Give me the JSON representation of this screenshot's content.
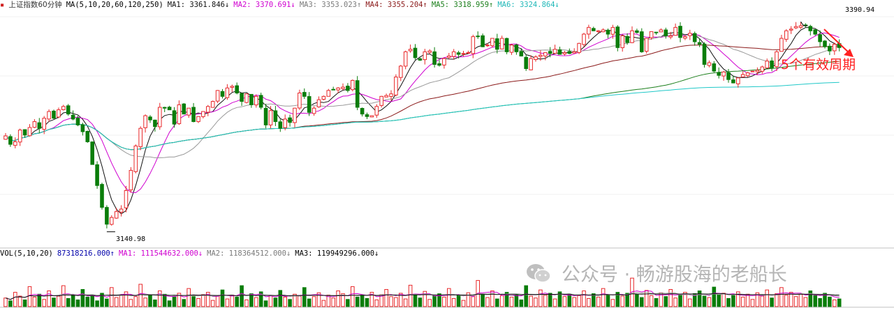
{
  "header": {
    "marker": "▪",
    "title": "上证指数60分钟",
    "ma_label": "MA(5,10,20,60,120,250)",
    "ma1": "MA1: 3361.846↓",
    "ma2": "MA2: 3370.691↓",
    "ma3": "MA3: 3353.023↑",
    "ma4": "MA4: 3355.204↑",
    "ma5": "MA5: 3318.959↑",
    "ma6": "MA6: 3324.864↓"
  },
  "volume_header": {
    "label": "VOL(5,10,20)",
    "value": "87318216.000↑",
    "ma1": "MA1: 111544632.000↓",
    "ma2": "MA2: 118364512.000↓",
    "ma3": "MA3: 119949296.000↓"
  },
  "annotations": {
    "high_label": "3390.94",
    "low_label": "3140.98",
    "note": "5个有效周期"
  },
  "watermark": {
    "text": "公众号 · 畅游股海的老船长",
    "logo": "wechat-logo"
  },
  "colors": {
    "up": "#e8282a",
    "down": "#0a7d0a",
    "ma1": "#101010",
    "ma2": "#d000d0",
    "ma3": "#9a9a9a",
    "ma4": "#8b1a1a",
    "ma5": "#1b7f1b",
    "ma6": "#20c8c8",
    "note": "#ff2020"
  },
  "chart_data": [
    {
      "type": "candlestick",
      "title": "上证指数60分钟",
      "ylim": [
        3125,
        3405
      ],
      "high": 3390.94,
      "low": 3140.98,
      "close": [
        3255.0,
        3245.0,
        3248.0,
        3262.0,
        3256.0,
        3265.0,
        3272.0,
        3264.0,
        3276.0,
        3284.0,
        3276.0,
        3286.0,
        3290.0,
        3281.0,
        3275.0,
        3268.0,
        3260.0,
        3248.0,
        3221.0,
        3196.0,
        3170.0,
        3150.0,
        3158.0,
        3165.0,
        3168.0,
        3190.0,
        3214.0,
        3243.0,
        3264.0,
        3279.0,
        3274.0,
        3266.0,
        3289.0,
        3288.0,
        3286.0,
        3269.0,
        3292.0,
        3281.0,
        3288.0,
        3272.0,
        3278.0,
        3284.0,
        3290.0,
        3296.0,
        3309.0,
        3302.0,
        3312.0,
        3314.0,
        3306.0,
        3296.0,
        3305.0,
        3292.0,
        3302.0,
        3289.0,
        3268.0,
        3285.0,
        3272.0,
        3264.0,
        3275.0,
        3271.0,
        3288.0,
        3306.0,
        3302.0,
        3283.0,
        3288.0,
        3298.0,
        3302.0,
        3309.0,
        3310.0,
        3312.0,
        3313.0,
        3309.0,
        3321.0,
        3289.0,
        3281.0,
        3278.0,
        3279.0,
        3290.0,
        3302.0,
        3303.0,
        3305.0,
        3325.0,
        3338.0,
        3355.0,
        3358.0,
        3348.0,
        3345.0,
        3355.0,
        3356.0,
        3340.0,
        3339.0,
        3347.0,
        3350.0,
        3355.0,
        3352.0,
        3353.0,
        3354.0,
        3373.0,
        3373.0,
        3361.0,
        3363.0,
        3371.0,
        3358.0,
        3371.0,
        3355.0,
        3363.0,
        3355.0,
        3350.0,
        3335.0,
        3347.0,
        3349.0,
        3351.0,
        3354.0,
        3353.0,
        3358.0,
        3352.0,
        3354.0,
        3353.0,
        3355.0,
        3365.0,
        3376.0,
        3384.0,
        3380.0,
        3380.0,
        3381.0,
        3376.0,
        3384.0,
        3360.0,
        3374.0,
        3366.0,
        3380.0,
        3378.0,
        3355.0,
        3371.0,
        3379.0,
        3378.0,
        3381.0,
        3374.0,
        3374.0,
        3384.0,
        3372.0,
        3373.0,
        3377.0,
        3367.0,
        3364.0,
        3340.0,
        3342.0,
        3332.0,
        3327.0,
        3331.0,
        3322.0,
        3318.0,
        3324.0,
        3328.0,
        3330.0,
        3332.0,
        3333.0,
        3337.0,
        3344.0,
        3336.0,
        3355.0,
        3371.0,
        3380.0,
        3382.0,
        3385.0,
        3386.0,
        3386.0,
        3380.0,
        3376.0,
        3367.0,
        3361.0,
        3356.0,
        3364.0,
        3360.0
      ],
      "ma_series": [
        {
          "name": "MA1",
          "period": 5,
          "color_key": "ma1"
        },
        {
          "name": "MA2",
          "period": 10,
          "color_key": "ma2"
        },
        {
          "name": "MA3",
          "period": 20,
          "color_key": "ma3"
        },
        {
          "name": "MA4",
          "period": 60,
          "color_key": "ma4"
        },
        {
          "name": "MA5",
          "period": 120,
          "color_key": "ma5"
        },
        {
          "name": "MA6",
          "period": 250,
          "color_key": "ma6"
        }
      ]
    },
    {
      "type": "bar",
      "title": "VOL(5,10,20)",
      "ylim": [
        0,
        100
      ],
      "note": "relative volume levels (0-100)",
      "values": [
        18,
        12,
        30,
        22,
        14,
        42,
        20,
        26,
        15,
        33,
        18,
        22,
        44,
        17,
        25,
        14,
        36,
        20,
        22,
        12,
        28,
        16,
        40,
        19,
        24,
        31,
        15,
        21,
        47,
        18,
        23,
        14,
        33,
        26,
        12,
        20,
        28,
        15,
        38,
        21,
        17,
        25,
        30,
        13,
        22,
        35,
        16,
        24,
        20,
        44,
        14,
        27,
        19,
        31,
        12,
        23,
        18,
        34,
        20,
        15,
        26,
        22,
        40,
        16,
        21,
        29,
        13,
        24,
        18,
        33,
        27,
        15,
        42,
        20,
        23,
        17,
        30,
        14,
        25,
        36,
        21,
        19,
        28,
        16,
        45,
        24,
        18,
        32,
        15,
        22,
        27,
        20,
        38,
        17,
        24,
        13,
        29,
        21,
        55,
        26,
        19,
        33,
        16,
        23,
        30,
        20,
        25,
        14,
        44,
        22,
        18,
        35,
        24,
        28,
        16,
        31,
        21,
        26,
        19,
        23,
        33,
        17,
        27,
        20,
        38,
        24,
        15,
        30,
        22,
        28,
        60,
        25,
        19,
        34,
        23,
        17,
        29,
        21,
        36,
        18,
        24,
        30,
        16,
        27,
        33,
        22,
        19,
        41,
        25,
        28,
        17,
        23,
        31,
        20,
        26,
        15,
        29,
        22,
        35,
        18,
        27,
        40,
        24,
        30,
        21,
        26,
        19,
        33,
        23,
        17,
        28,
        20,
        14,
        16
      ],
      "ma_series": [
        {
          "name": "MA1",
          "period": 5,
          "color_key": "ma1"
        },
        {
          "name": "MA2",
          "period": 10,
          "color_key": "ma2"
        },
        {
          "name": "MA3",
          "period": 20,
          "color_key": "ma3"
        }
      ]
    }
  ]
}
